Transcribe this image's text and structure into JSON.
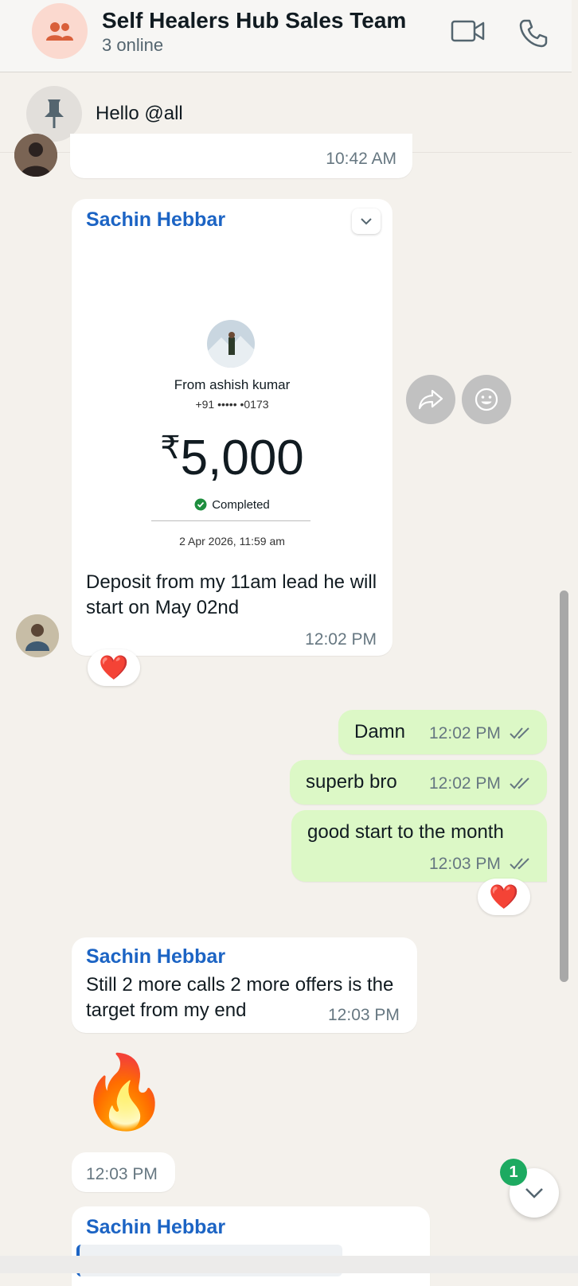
{
  "header": {
    "title": "Self Healers Hub Sales Team",
    "status": "3 online",
    "video_icon": "video-camera-icon",
    "call_icon": "phone-icon"
  },
  "pinned": {
    "icon": "pin-icon",
    "text": "Hello @all"
  },
  "messages": {
    "prev_time": "10:42 AM",
    "payment": {
      "sender": "Sachin Hebbar",
      "from": "From ashish kumar",
      "phone": "+91 ••••• •0173",
      "currency": "₹",
      "amount": "5,000",
      "status": "Completed",
      "date": "2 Apr 2026, 11:59 am",
      "caption": "Deposit from my 11am lead he will start on May 02nd",
      "time": "12:02 PM",
      "reaction": "❤️"
    },
    "out": [
      {
        "text": "Damn",
        "time": "12:02 PM"
      },
      {
        "text": "superb bro",
        "time": "12:02 PM"
      },
      {
        "text": "good start to the month",
        "time": "12:03 PM"
      }
    ],
    "out_reaction": "❤️",
    "in2": {
      "sender": "Sachin Hebbar",
      "text": "Still 2 more calls 2 more offers is the target from my end",
      "time": "12:03 PM"
    },
    "emoji": {
      "glyph": "🔥",
      "time": "12:03 PM"
    },
    "in3": {
      "sender": "Sachin Hebbar"
    }
  },
  "unread_count": "1",
  "colors": {
    "accent": "#1c64c4",
    "outgoing": "#dcf8c6",
    "badge": "#1daa61"
  }
}
